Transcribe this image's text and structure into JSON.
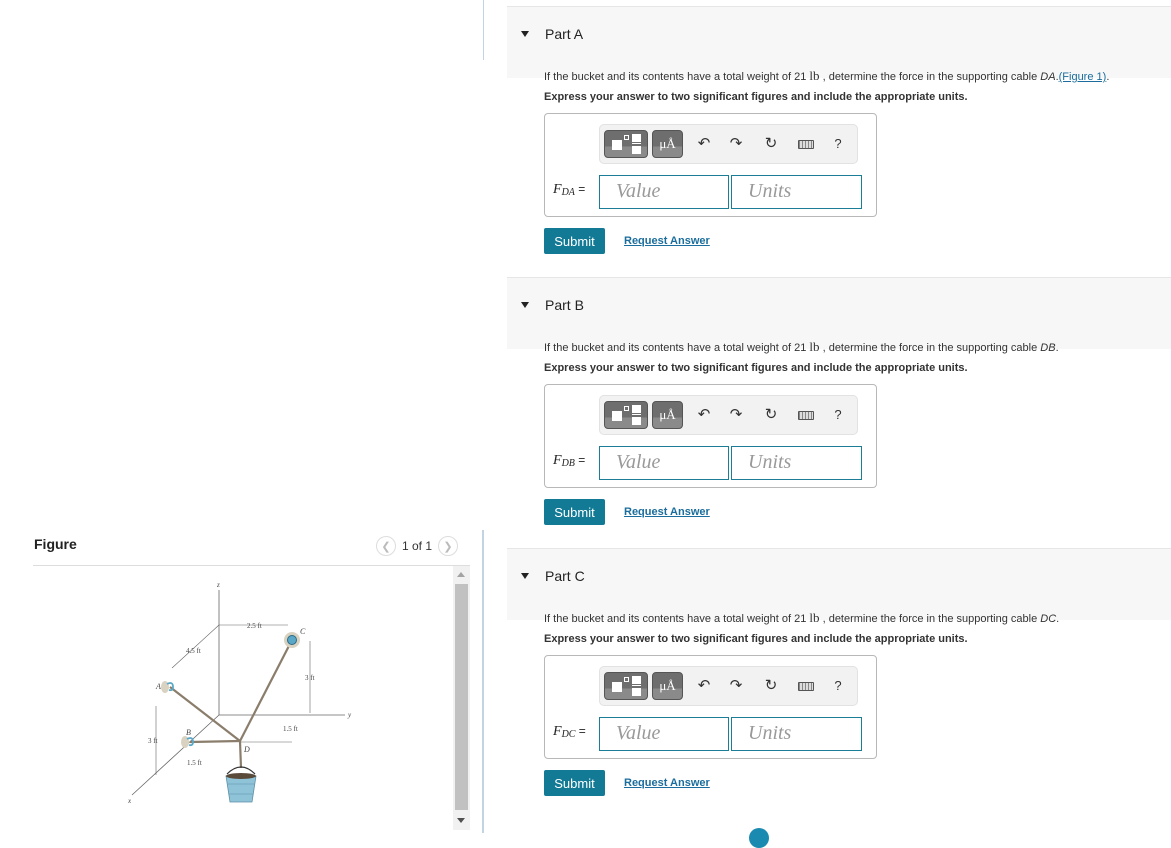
{
  "figure_panel": {
    "title": "Figure",
    "pager": {
      "prev_icon": "chevron-left-icon",
      "next_icon": "chevron-right-icon",
      "label": "1 of 1"
    },
    "diagram_labels": {
      "axis_z": "z",
      "axis_y": "y",
      "axis_x": "x",
      "point_a": "A",
      "point_b": "B",
      "point_c": "C",
      "point_d": "D",
      "dim_2_5": "2.5 ft",
      "dim_4_5": "4.5 ft",
      "dim_3_right": "3 ft",
      "dim_3_left": "3 ft",
      "dim_1_5_right": "1.5 ft",
      "dim_1_5_bottom": "1.5 ft"
    }
  },
  "parts": [
    {
      "title": "Part A",
      "question_prefix": "If the bucket and its contents have a total weight of 21 ",
      "weight_unit": "lb",
      "question_mid": " , determine the force in the supporting cable ",
      "cable": "DA",
      "question_suffix": ".",
      "figure_link": "(Figure 1)",
      "figure_link_suffix": ".",
      "instruction": "Express your answer to two significant figures and include the appropriate units.",
      "var_main": "F",
      "var_sub": "DA",
      "equals": " =",
      "value_placeholder": "Value",
      "units_placeholder": "Units",
      "submit": "Submit",
      "request_answer": "Request Answer"
    },
    {
      "title": "Part B",
      "question_prefix": "If the bucket and its contents have a total weight of 21 ",
      "weight_unit": "lb",
      "question_mid": " , determine the force in the supporting cable ",
      "cable": "DB",
      "question_suffix": ".",
      "instruction": "Express your answer to two significant figures and include the appropriate units.",
      "var_main": "F",
      "var_sub": "DB",
      "equals": " =",
      "value_placeholder": "Value",
      "units_placeholder": "Units",
      "submit": "Submit",
      "request_answer": "Request Answer"
    },
    {
      "title": "Part C",
      "question_prefix": "If the bucket and its contents have a total weight of 21 ",
      "weight_unit": "lb",
      "question_mid": " , determine the force in the supporting cable ",
      "cable": "DC",
      "question_suffix": ".",
      "instruction": "Express your answer to two significant figures and include the appropriate units.",
      "var_main": "F",
      "var_sub": "DC",
      "equals": " =",
      "value_placeholder": "Value",
      "units_placeholder": "Units",
      "submit": "Submit",
      "request_answer": "Request Answer"
    }
  ],
  "toolbar": {
    "templates_icon": "templates-icon",
    "units_button": "μÅ",
    "undo_icon": "↶",
    "redo_icon": "↷",
    "reset_icon": "↻",
    "keyboard_icon": "keyboard-icon",
    "help": "?"
  },
  "colors": {
    "accent": "#137a96",
    "link": "#1a6d9c",
    "header_bg": "#f7f7f7"
  }
}
